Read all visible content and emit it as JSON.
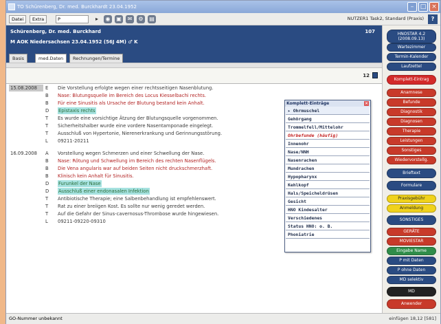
{
  "window": {
    "title": "TO Schürenberg, Dr. med. Burckhardt 23.04.1952"
  },
  "toolbar": {
    "datei": "Datei",
    "extra": "Extra",
    "input_value": "P",
    "user": "NUTZER1 Task2, Standard (Praxis)",
    "help": "?"
  },
  "patient": {
    "name": "Schürenberg, Dr. med. Burckhard",
    "insurance_line": "M AOK Niedersachsen 23.04.1952 (56J 4M) ♂ K",
    "number": "107"
  },
  "tabs": [
    "Basis",
    "med.Daten",
    "Rechnungen/Termine"
  ],
  "page_number": "12",
  "entries": [
    {
      "date": "15.08.2008",
      "selected": true,
      "lines": [
        {
          "code": "E",
          "text": "Die Vorstellung erfolgte wegen einer rechtsseitigen Nasenblutung.",
          "kind": "cE"
        },
        {
          "code": "B",
          "text": "Nase: Blutungsquelle im Bereich des Locus Kiesselbachi rechts.",
          "kind": "cB"
        },
        {
          "code": "B",
          "text": "Für eine Sinusitis als Ursache der Blutung bestand kein Anhalt.",
          "kind": "cB"
        },
        {
          "code": "D",
          "text": "Epistaxis rechts",
          "kind": "cD",
          "highlight": true
        },
        {
          "code": "T",
          "text": "Es wurde eine vorsichtige Ätzung der Blutungsquelle vorgenommen.",
          "kind": "cT"
        },
        {
          "code": "T",
          "text": "Sicherheitshalber wurde eine vordere Nasentamponade eingelegt.",
          "kind": "cT"
        },
        {
          "code": "T",
          "text": "Ausschluß von Hypertonie, Nierenerkrankung und Gerinnungsstörung.",
          "kind": "cT"
        },
        {
          "code": "L",
          "text": "09211-20211",
          "kind": "cL"
        }
      ]
    },
    {
      "date": "16.09.2008",
      "selected": false,
      "lines": [
        {
          "code": "A",
          "text": "Vorstellung wegen Schmerzen und einer Schwellung der Nase.",
          "kind": "cA"
        },
        {
          "code": "B",
          "text": "Nase: Rötung und Schwellung im Bereich des rechten Nasenflügels.",
          "kind": "cB"
        },
        {
          "code": "B",
          "text": "Die Vena angularis war auf beiden Seiten nicht druckschmerzhaft.",
          "kind": "cB"
        },
        {
          "code": "B",
          "text": "Klinisch kein Anhalt für Sinusitis.",
          "kind": "cB"
        },
        {
          "code": "D",
          "text": "Furunkel der Nase",
          "kind": "cD",
          "highlight": true
        },
        {
          "code": "D",
          "text": "Ausschluß einer endonasalen Infektion",
          "kind": "cD",
          "highlight": true
        },
        {
          "code": "T",
          "text": "Antibiotische Therapie; eine Salbenbehandlung ist empfehlenswert.",
          "kind": "cT"
        },
        {
          "code": "T",
          "text": "Rat zu einer breiigen Kost. Es sollte nur wenig geredet werden.",
          "kind": "cT"
        },
        {
          "code": "T",
          "text": "Auf die Gefahr der Sinus-cavernosus-Thrombose wurde hingewiesen.",
          "kind": "cT"
        },
        {
          "code": "L",
          "text": "09211-09220-09310",
          "kind": "cL"
        }
      ]
    }
  ],
  "popup": {
    "title": "Komplett-Einträge",
    "items": [
      "▸ Ohrmuschel",
      "Gehörgang",
      "Trommelfell/Mittelohr",
      "Ohrbefunde (häufig)",
      "Innenohr",
      "Nase/NNH",
      "Nasenrachen",
      "Mundrachen",
      "Hypopharynx",
      "Kehlkopf",
      "Hals/Speicheldrüsen",
      "Gesicht",
      "HNO Kindesalter",
      "Verschiedenes",
      "Status HNO: o. B.",
      "Phoniatrie"
    ]
  },
  "sidebar": [
    {
      "label": "HNOSTAR 4.2\n(2008.09.13)",
      "bg": "#2a4b82",
      "fg": "#ffffff"
    },
    {
      "label": "Wartezimmer",
      "bg": "#2a4b82",
      "fg": "#ffffff"
    },
    {
      "label": "Termin-Kalender",
      "bg": "#2a4b82",
      "fg": "#ffffff"
    },
    {
      "label": "Laufzettel",
      "bg": "#2a4b82",
      "fg": "#ffffff"
    },
    {
      "label": "Komplett-Eintrag",
      "bg": "#d32a2a",
      "fg": "#ffffff"
    },
    {
      "label": "Anamnese",
      "bg": "#c83a2a",
      "fg": "#ffffff"
    },
    {
      "label": "Befunde",
      "bg": "#c83a2a",
      "fg": "#ffffff"
    },
    {
      "label": "Diagnostik",
      "bg": "#c83a2a",
      "fg": "#ffffff"
    },
    {
      "label": "Diagnosen",
      "bg": "#c83a2a",
      "fg": "#ffffff"
    },
    {
      "label": "Therapie",
      "bg": "#c83a2a",
      "fg": "#ffffff"
    },
    {
      "label": "Leistungen",
      "bg": "#c83a2a",
      "fg": "#ffffff"
    },
    {
      "label": "Sonstiges",
      "bg": "#c83a2a",
      "fg": "#ffffff"
    },
    {
      "label": "Wiedervorstellg.",
      "bg": "#c83a2a",
      "fg": "#ffffff"
    },
    {
      "label": "Brieftext",
      "bg": "#2a4b82",
      "fg": "#ffffff"
    },
    {
      "label": "Formulare",
      "bg": "#2a4b82",
      "fg": "#ffffff"
    },
    {
      "label": "Praxisgebühr",
      "bg": "#f0d21c",
      "fg": "#222222"
    },
    {
      "label": "Anmeldung",
      "bg": "#f0d21c",
      "fg": "#222222"
    },
    {
      "label": "SONSTIGES",
      "bg": "#2a4b82",
      "fg": "#ffffff"
    },
    {
      "label": "GERÄTE",
      "bg": "#c83a2a",
      "fg": "#ffffff"
    },
    {
      "label": "MOVIESTAR",
      "bg": "#c83a2a",
      "fg": "#ffffff"
    },
    {
      "label": "Eingabe Name",
      "bg": "#2f8d4a",
      "fg": "#ffffff"
    },
    {
      "label": "P mit Daten",
      "bg": "#2a4b82",
      "fg": "#ffffff"
    },
    {
      "label": "P ohne Daten",
      "bg": "#2a4b82",
      "fg": "#ffffff"
    },
    {
      "label": "MD selektiv",
      "bg": "#2a4b82",
      "fg": "#ffffff"
    },
    {
      "label": "MD",
      "bg": "#222222",
      "fg": "#ffffff"
    },
    {
      "label": "Anwender",
      "bg": "#c83a2a",
      "fg": "#ffffff"
    }
  ],
  "status": {
    "left": "GO-Nummer unbekannt",
    "right": "einfügen  18,12 [581]"
  }
}
